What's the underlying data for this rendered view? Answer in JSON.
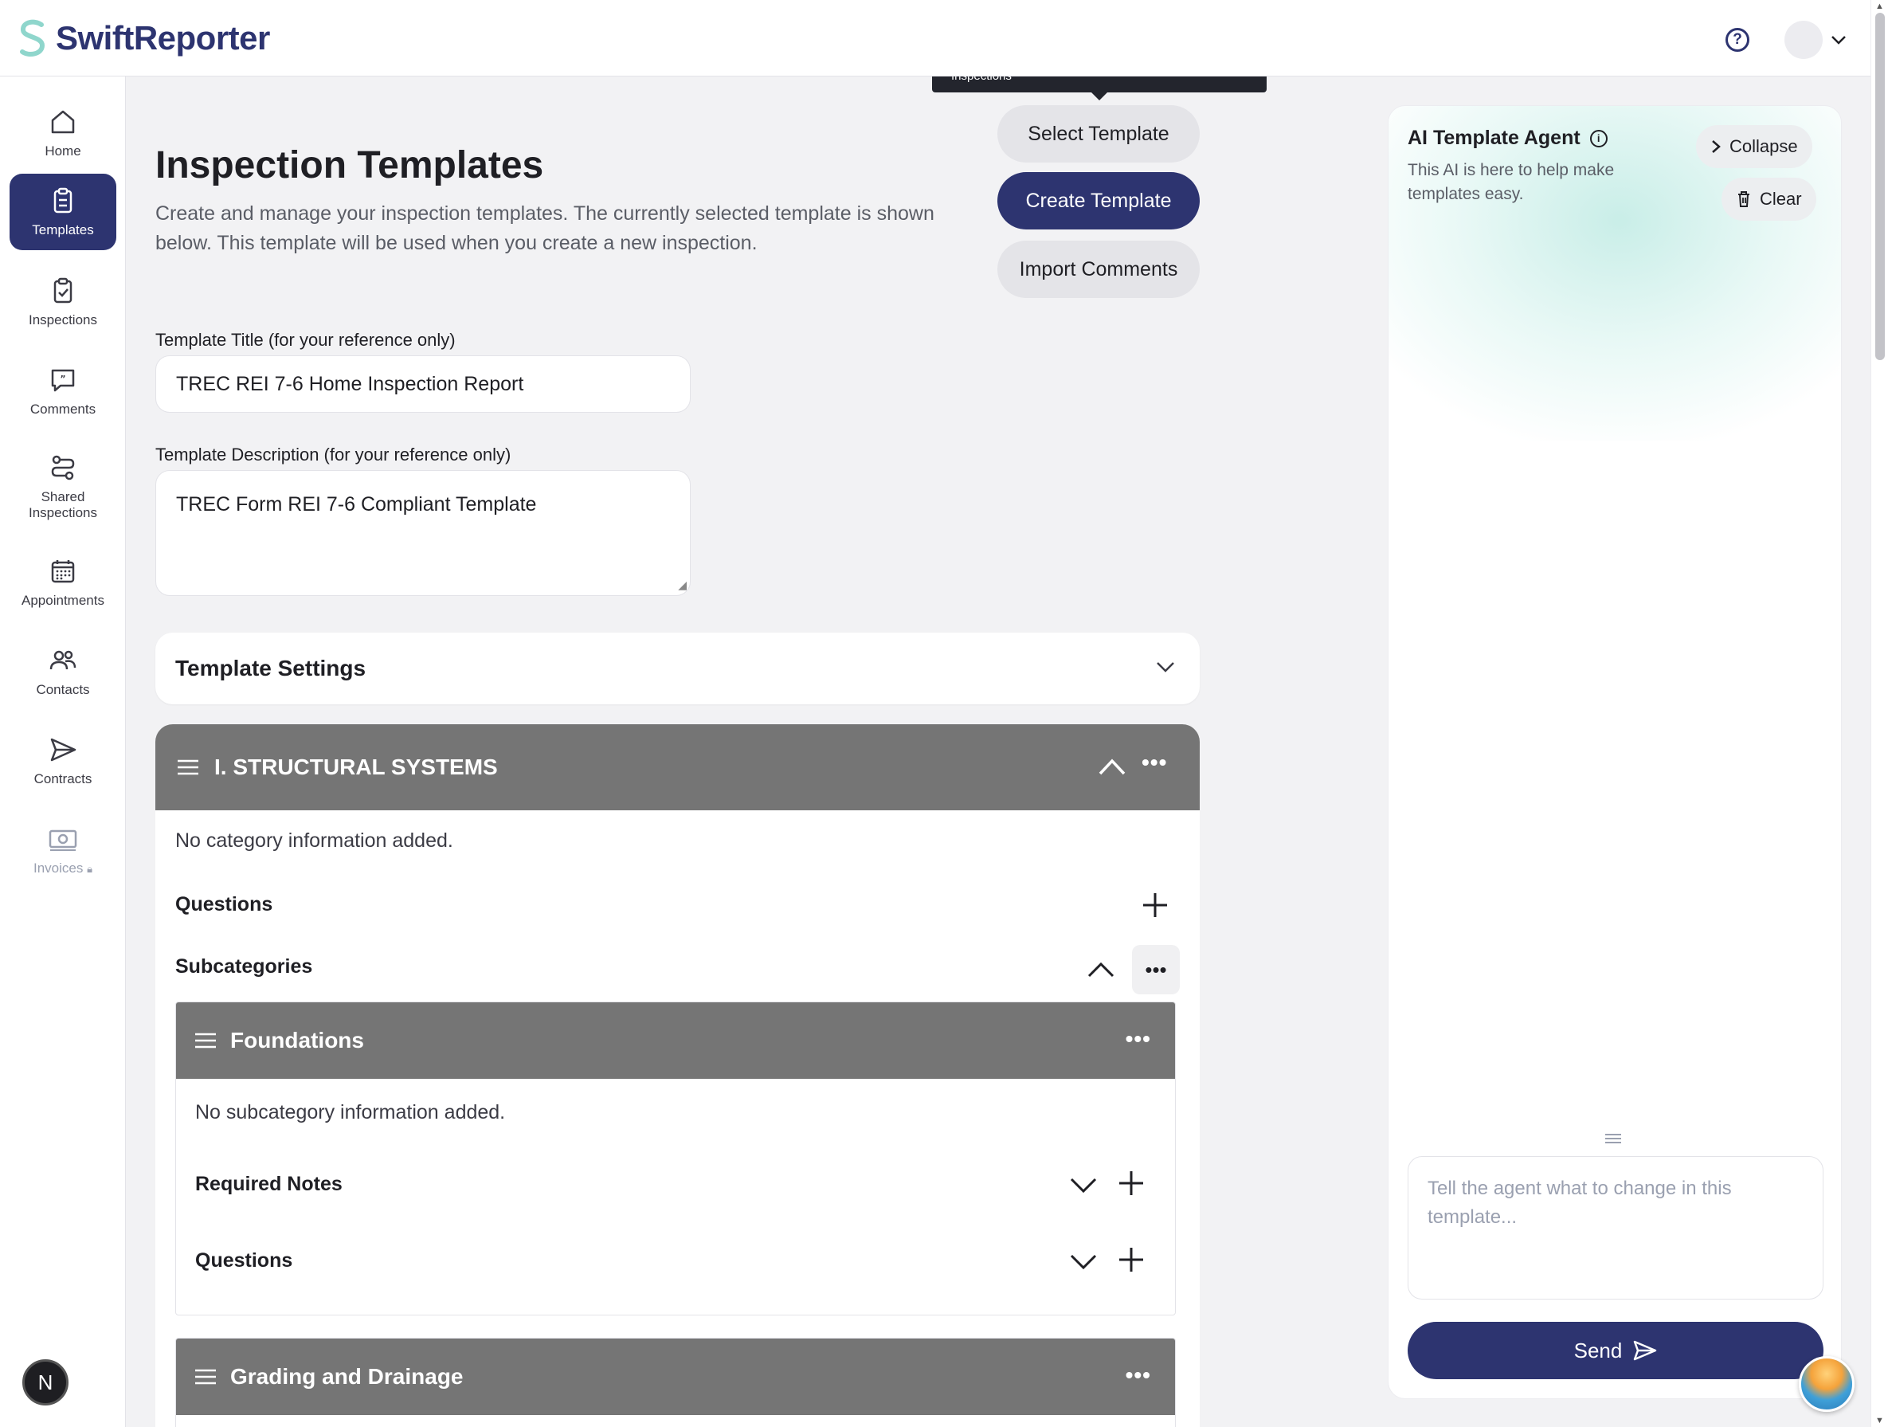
{
  "app": {
    "name": "SwiftReporter"
  },
  "nav": {
    "home": "Home",
    "templates": "Templates",
    "inspections": "Inspections",
    "comments": "Comments",
    "shared_line1": "Shared",
    "shared_line2": "Inspections",
    "appointments": "Appointments",
    "contacts": "Contacts",
    "contracts": "Contracts",
    "invoices": "Invoices"
  },
  "page": {
    "title": "Inspection Templates",
    "description": "Create and manage your inspection templates. The currently selected template is shown below. This template will be used when you create a new inspection.",
    "tooltip": "Inspections"
  },
  "actions": {
    "select_template": "Select Template",
    "create_template": "Create Template",
    "import_comments": "Import Comments"
  },
  "form": {
    "title_label": "Template Title (for your reference only)",
    "title_value": "TREC REI 7-6 Home Inspection Report",
    "desc_label": "Template Description (for your reference only)",
    "desc_value": "TREC Form REI 7-6 Compliant Template"
  },
  "settings": {
    "label": "Template Settings"
  },
  "category": {
    "name": "I. STRUCTURAL SYSTEMS",
    "empty": "No category information added.",
    "questions_label": "Questions",
    "subcategories_label": "Subcategories",
    "subcategories": [
      {
        "name": "Foundations",
        "empty": "No subcategory information added.",
        "required_notes_label": "Required Notes",
        "questions_label": "Questions"
      },
      {
        "name": "Grading and Drainage"
      }
    ]
  },
  "ai": {
    "title": "AI Template Agent",
    "description": "This AI is here to help make templates easy.",
    "collapse": "Collapse",
    "clear": "Clear",
    "placeholder": "Tell the agent what to change in this template...",
    "send": "Send"
  },
  "badge": {
    "letter": "N"
  },
  "colors": {
    "brand": "#2d3470",
    "header_grey": "#757575",
    "accent_teal": "#b7e8e0"
  }
}
